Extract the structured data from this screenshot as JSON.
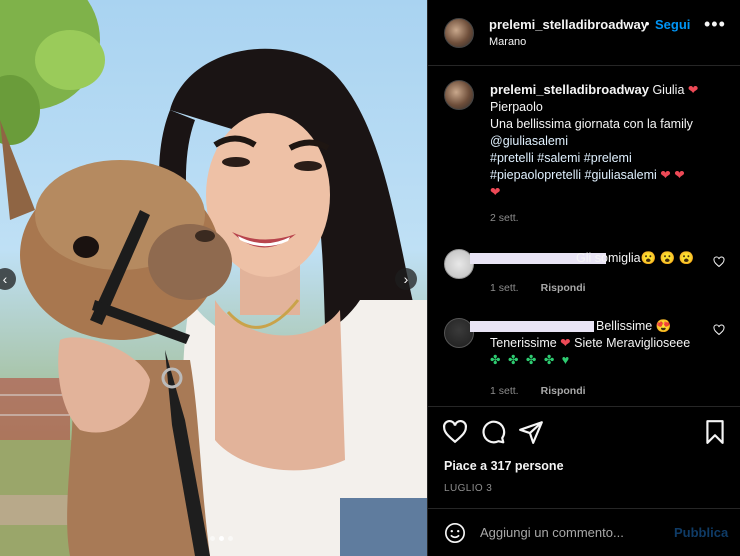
{
  "post": {
    "username": "prelemi_stelladibroadway",
    "bullet": "•",
    "follow_label": "Segui",
    "location": "Marano",
    "more_label": "•••"
  },
  "caption": {
    "username": "prelemi_stelladibroadway",
    "line1": "Giulia ",
    "heart1": "❤",
    "line2": "Pierpaolo",
    "line3": "Una bellissima giornata con la family",
    "mention": "@giuliasalemi",
    "tags1": "#pretelli #salemi #prelemi",
    "tags2": "#piepaolopretelli #giuliasalemi ",
    "hearts2": "❤ ❤",
    "heart3": "❤",
    "time": "2 sett."
  },
  "comments": [
    {
      "text": "Gli somiglia😮 😮 😮",
      "time": "1 sett.",
      "reply_label": "Rispondi"
    },
    {
      "text1": "Bellissime 😍",
      "text2_a": "Tenerissime ",
      "text2_heart": "❤",
      "text2_b": " Siete Meraviglioseee",
      "text3": "✤ ✤ ✤ ✤ ♥",
      "time": "1 sett.",
      "reply_label": "Rispondi"
    }
  ],
  "likes_text": "Piace a 317 persone",
  "date": "LUGLIO 3",
  "comment_placeholder": "Aggiungi un commento...",
  "publish_label": "Pubblica",
  "carousel": {
    "prev": "‹",
    "next": "›"
  },
  "colors": {
    "accent": "#0095f6",
    "heart": "#ed4956",
    "background": "#000000",
    "muted": "#8e8e8e"
  },
  "icons": [
    "heart-icon",
    "comment-icon",
    "share-icon",
    "bookmark-icon",
    "emoji-icon",
    "more-icon",
    "chevron-left-icon",
    "chevron-right-icon"
  ]
}
